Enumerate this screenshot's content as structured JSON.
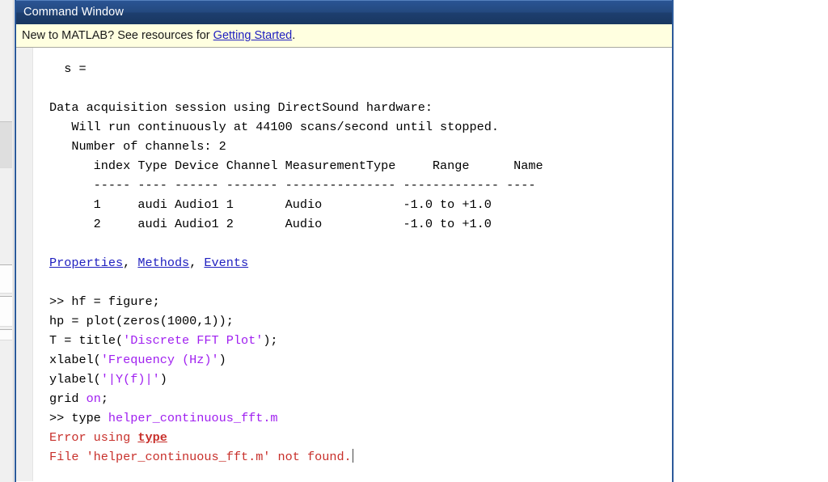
{
  "window": {
    "title": "Command Window"
  },
  "banner": {
    "prefix": "New to MATLAB? See resources for ",
    "link_label": "Getting Started",
    "suffix": "."
  },
  "console": {
    "lines": [
      {
        "id": "l01",
        "segments": [
          {
            "text": "  s = ",
            "style": "plain"
          }
        ]
      },
      {
        "id": "l02",
        "segments": [
          {
            "text": "",
            "style": "plain"
          }
        ]
      },
      {
        "id": "l03",
        "segments": [
          {
            "text": "Data acquisition session using DirectSound hardware:",
            "style": "plain"
          }
        ]
      },
      {
        "id": "l04",
        "segments": [
          {
            "text": "   Will run continuously at 44100 scans/second until stopped.",
            "style": "plain"
          }
        ]
      },
      {
        "id": "l05",
        "segments": [
          {
            "text": "   Number of channels: 2",
            "style": "plain"
          }
        ]
      },
      {
        "id": "l06",
        "segments": [
          {
            "text": "      index Type Device Channel MeasurementType     Range      Name",
            "style": "plain"
          }
        ]
      },
      {
        "id": "l07",
        "segments": [
          {
            "text": "      ----- ---- ------ ------- --------------- ------------- ----",
            "style": "plain"
          }
        ]
      },
      {
        "id": "l08",
        "segments": [
          {
            "text": "      1     audi Audio1 1       Audio           -1.0 to +1.0",
            "style": "plain"
          }
        ]
      },
      {
        "id": "l09",
        "segments": [
          {
            "text": "      2     audi Audio1 2       Audio           -1.0 to +1.0",
            "style": "plain"
          }
        ]
      },
      {
        "id": "l10",
        "segments": [
          {
            "text": "",
            "style": "plain"
          }
        ]
      },
      {
        "id": "l11",
        "segments": [
          {
            "text": "Properties",
            "style": "link"
          },
          {
            "text": ", ",
            "style": "plain"
          },
          {
            "text": "Methods",
            "style": "link"
          },
          {
            "text": ", ",
            "style": "plain"
          },
          {
            "text": "Events",
            "style": "link"
          }
        ]
      },
      {
        "id": "l12",
        "segments": [
          {
            "text": "",
            "style": "plain"
          }
        ]
      },
      {
        "id": "l13",
        "segments": [
          {
            "text": ">> hf = figure;",
            "style": "plain"
          }
        ]
      },
      {
        "id": "l14",
        "segments": [
          {
            "text": "hp = plot(zeros(1000,1));",
            "style": "plain"
          }
        ]
      },
      {
        "id": "l15",
        "segments": [
          {
            "text": "T = title(",
            "style": "plain"
          },
          {
            "text": "'Discrete FFT Plot'",
            "style": "string"
          },
          {
            "text": ");",
            "style": "plain"
          }
        ]
      },
      {
        "id": "l16",
        "segments": [
          {
            "text": "xlabel(",
            "style": "plain"
          },
          {
            "text": "'Frequency (Hz)'",
            "style": "string"
          },
          {
            "text": ")",
            "style": "plain"
          }
        ]
      },
      {
        "id": "l17",
        "segments": [
          {
            "text": "ylabel(",
            "style": "plain"
          },
          {
            "text": "'|Y(f)|'",
            "style": "string"
          },
          {
            "text": ")",
            "style": "plain"
          }
        ]
      },
      {
        "id": "l18",
        "segments": [
          {
            "text": "grid ",
            "style": "plain"
          },
          {
            "text": "on",
            "style": "string"
          },
          {
            "text": ";",
            "style": "plain"
          }
        ]
      },
      {
        "id": "l19",
        "segments": [
          {
            "text": ">> type ",
            "style": "plain"
          },
          {
            "text": "helper_continuous_fft.m",
            "style": "string"
          }
        ]
      },
      {
        "id": "l20",
        "segments": [
          {
            "text": "Error using ",
            "style": "error"
          },
          {
            "text": "type",
            "style": "errorfn"
          }
        ]
      },
      {
        "id": "l21",
        "segments": [
          {
            "text": "File 'helper_continuous_fft.m' not found.",
            "style": "error"
          },
          {
            "text": "",
            "style": "caret"
          }
        ]
      }
    ]
  },
  "colors": {
    "titlebar_blue": "#24497f",
    "banner_yellow": "#ffffe0",
    "link_blue": "#2020c0",
    "string_purple": "#a020f0",
    "error_red": "#c8302b",
    "window_border": "#2c5a9a"
  }
}
